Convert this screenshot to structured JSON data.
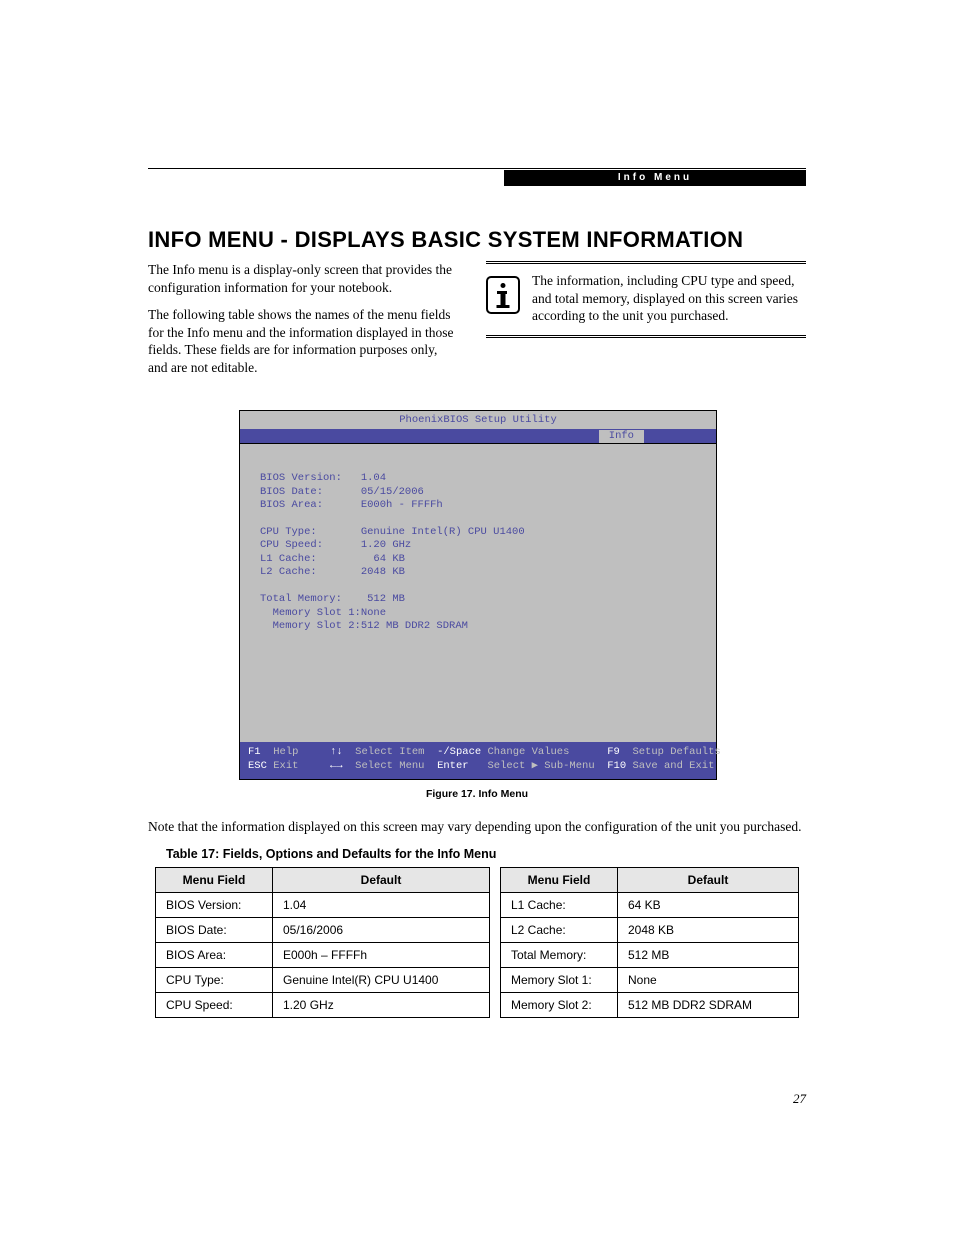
{
  "header": {
    "stripe_label": "Info Menu"
  },
  "title": "INFO MENU - DISPLAYS BASIC SYSTEM INFORMATION",
  "intro": {
    "p1": "The Info menu is a display-only screen that provides the configuration information for your notebook.",
    "p2": "The following table shows the names of the menu fields for the Info menu and the information displayed in those fields. These fields are for information purposes only, and are not editable."
  },
  "note": "The information, including CPU type and speed, and total memory, displayed on this screen varies according to the unit you purchased.",
  "bios": {
    "title": "PhoenixBIOS Setup Utility",
    "tab": "Info",
    "fields": [
      [
        "BIOS Version:",
        "1.04"
      ],
      [
        "BIOS Date:",
        "05/15/2006"
      ],
      [
        "BIOS Area:",
        "E000h - FFFFh"
      ],
      [
        "",
        ""
      ],
      [
        "CPU Type:",
        "Genuine Intel(R) CPU U1400"
      ],
      [
        "CPU Speed:",
        "1.20 GHz"
      ],
      [
        "L1 Cache:",
        "  64 KB"
      ],
      [
        "L2 Cache:",
        "2048 KB"
      ],
      [
        "",
        ""
      ],
      [
        "Total Memory:",
        " 512 MB"
      ],
      [
        "  Memory Slot 1:",
        "None"
      ],
      [
        "  Memory Slot 2:",
        "512 MB DDR2 SDRAM"
      ]
    ],
    "footer": {
      "r1": [
        {
          "k": "F1",
          "v": "Help"
        },
        {
          "k": "↑↓",
          "v": "Select Item"
        },
        {
          "k": "-/Space",
          "v": "Change Values"
        },
        {
          "k": "F9",
          "v": "Setup Defaults"
        }
      ],
      "r2": [
        {
          "k": "ESC",
          "v": "Exit"
        },
        {
          "k": "←→",
          "v": "Select Menu"
        },
        {
          "k": "Enter",
          "v": "Select ▶ Sub-Menu"
        },
        {
          "k": "F10",
          "v": "Save and Exit"
        }
      ]
    }
  },
  "figure_caption": "Figure 17.  Info Menu",
  "post_note": "Note that the information displayed on this screen may vary depending upon the configuration of the unit you purchased.",
  "table_title": "Table 17: Fields, Options and Defaults for the Info Menu",
  "table": {
    "headers": [
      "Menu Field",
      "Default",
      "Menu Field",
      "Default"
    ],
    "rows": [
      [
        "BIOS Version:",
        "1.04",
        "L1 Cache:",
        "64 KB"
      ],
      [
        "BIOS Date:",
        "05/16/2006",
        "L2 Cache:",
        "2048 KB"
      ],
      [
        "BIOS Area:",
        "E000h – FFFFh",
        "Total Memory:",
        "512 MB"
      ],
      [
        "CPU Type:",
        "Genuine Intel(R) CPU U1400",
        "Memory Slot 1:",
        "None"
      ],
      [
        "CPU Speed:",
        "1.20 GHz",
        "Memory Slot 2:",
        "512 MB DDR2 SDRAM"
      ]
    ]
  },
  "page_number": "27"
}
